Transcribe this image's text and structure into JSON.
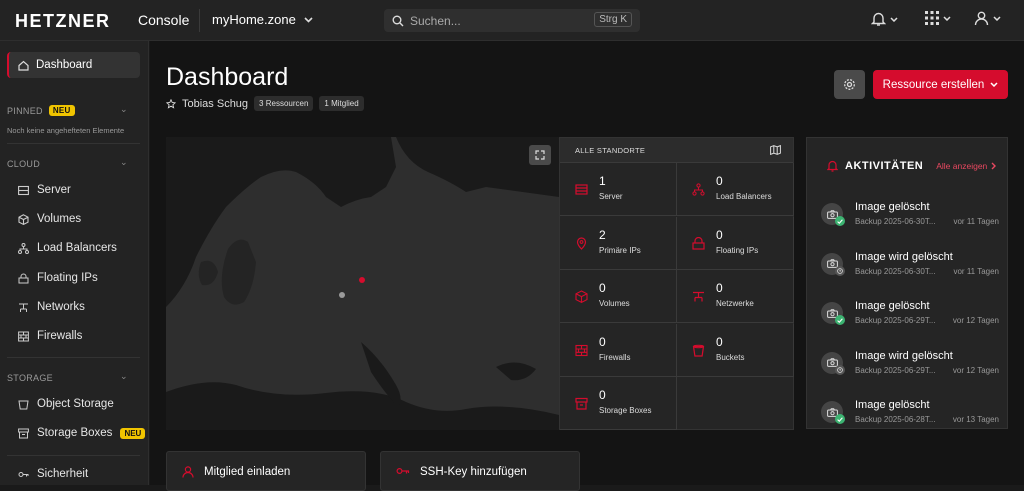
{
  "topbar": {
    "logo": "HETZNER",
    "product": "Console",
    "project": "myHome.zone",
    "search_placeholder": "Suchen...",
    "search_shortcut": "Strg K"
  },
  "sidebar": {
    "active_item": "Dashboard",
    "pinned": {
      "label": "PINNED",
      "badge": "NEU",
      "empty_note": "Noch keine angehefteten Elemente"
    },
    "cloud": {
      "label": "CLOUD",
      "items": [
        "Server",
        "Volumes",
        "Load Balancers",
        "Floating IPs",
        "Networks",
        "Firewalls"
      ]
    },
    "storage": {
      "label": "STORAGE",
      "items": [
        "Object Storage",
        "Storage Boxes"
      ],
      "storage_boxes_badge": "NEU"
    },
    "security_item": "Sicherheit"
  },
  "page": {
    "title": "Dashboard",
    "owner": "Tobias Schug",
    "resources_pill": "3 Ressourcen",
    "members_pill": "1 Mitglied",
    "create_button": "Ressource erstellen"
  },
  "resources": {
    "header": "ALLE STANDORTE",
    "cells": [
      {
        "count": "1",
        "label": "Server",
        "icon": "server-icon"
      },
      {
        "count": "0",
        "label": "Load Balancers",
        "icon": "load-balancer-icon"
      },
      {
        "count": "2",
        "label": "Primäre IPs",
        "icon": "location-pin-icon"
      },
      {
        "count": "0",
        "label": "Floating IPs",
        "icon": "floating-ip-icon"
      },
      {
        "count": "0",
        "label": "Volumes",
        "icon": "volume-icon"
      },
      {
        "count": "0",
        "label": "Netzwerke",
        "icon": "network-icon"
      },
      {
        "count": "0",
        "label": "Firewalls",
        "icon": "firewall-icon"
      },
      {
        "count": "0",
        "label": "Buckets",
        "icon": "bucket-icon"
      },
      {
        "count": "0",
        "label": "Storage Boxes",
        "icon": "storage-box-icon"
      }
    ]
  },
  "activity": {
    "title": "AKTIVITÄTEN",
    "show_all": "Alle anzeigen",
    "items": [
      {
        "title": "Image gelöscht",
        "sub": "Backup 2025-06-30T...",
        "time": "vor 11 Tagen",
        "status": "done"
      },
      {
        "title": "Image wird gelöscht",
        "sub": "Backup 2025-06-30T...",
        "time": "vor 11 Tagen",
        "status": "pending"
      },
      {
        "title": "Image gelöscht",
        "sub": "Backup 2025-06-29T...",
        "time": "vor 12 Tagen",
        "status": "done"
      },
      {
        "title": "Image wird gelöscht",
        "sub": "Backup 2025-06-29T...",
        "time": "vor 12 Tagen",
        "status": "pending"
      },
      {
        "title": "Image gelöscht",
        "sub": "Backup 2025-06-28T...",
        "time": "vor 13 Tagen",
        "status": "done"
      }
    ]
  },
  "quick_actions": [
    "Mitglied einladen",
    "SSH-Key hinzufügen"
  ],
  "colors": {
    "accent": "#d50c2d",
    "success": "#3cb371",
    "badge": "#f0c400"
  }
}
